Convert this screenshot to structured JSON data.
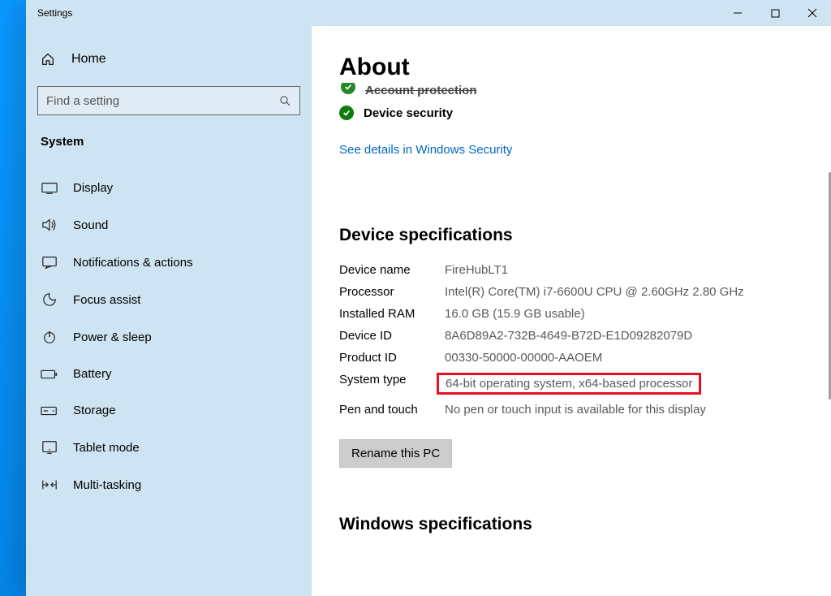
{
  "window": {
    "title": "Settings"
  },
  "sidebar": {
    "home": "Home",
    "search_placeholder": "Find a setting",
    "section": "System",
    "items": [
      {
        "id": "display",
        "label": "Display"
      },
      {
        "id": "sound",
        "label": "Sound"
      },
      {
        "id": "notifications",
        "label": "Notifications & actions"
      },
      {
        "id": "focus",
        "label": "Focus assist"
      },
      {
        "id": "power",
        "label": "Power & sleep"
      },
      {
        "id": "battery",
        "label": "Battery"
      },
      {
        "id": "storage",
        "label": "Storage"
      },
      {
        "id": "tablet",
        "label": "Tablet mode"
      },
      {
        "id": "multitask",
        "label": "Multi-tasking"
      }
    ]
  },
  "content": {
    "page_title": "About",
    "security_cutoff_label": "Account protection",
    "security_item_label": "Device security",
    "security_link": "See details in Windows Security",
    "device_spec_heading": "Device specifications",
    "specs": {
      "device_name": {
        "k": "Device name",
        "v": "FireHubLT1"
      },
      "processor": {
        "k": "Processor",
        "v": "Intel(R) Core(TM) i7-6600U CPU @ 2.60GHz   2.80 GHz"
      },
      "ram": {
        "k": "Installed RAM",
        "v": "16.0 GB (15.9 GB usable)"
      },
      "device_id": {
        "k": "Device ID",
        "v": "8A6D89A2-732B-4649-B72D-E1D09282079D"
      },
      "product_id": {
        "k": "Product ID",
        "v": "00330-50000-00000-AAOEM"
      },
      "system_type": {
        "k": "System type",
        "v": "64-bit operating system, x64-based processor"
      },
      "pen_touch": {
        "k": "Pen and touch",
        "v": "No pen or touch input is available for this display"
      }
    },
    "rename_button": "Rename this PC",
    "windows_spec_heading": "Windows specifications"
  }
}
